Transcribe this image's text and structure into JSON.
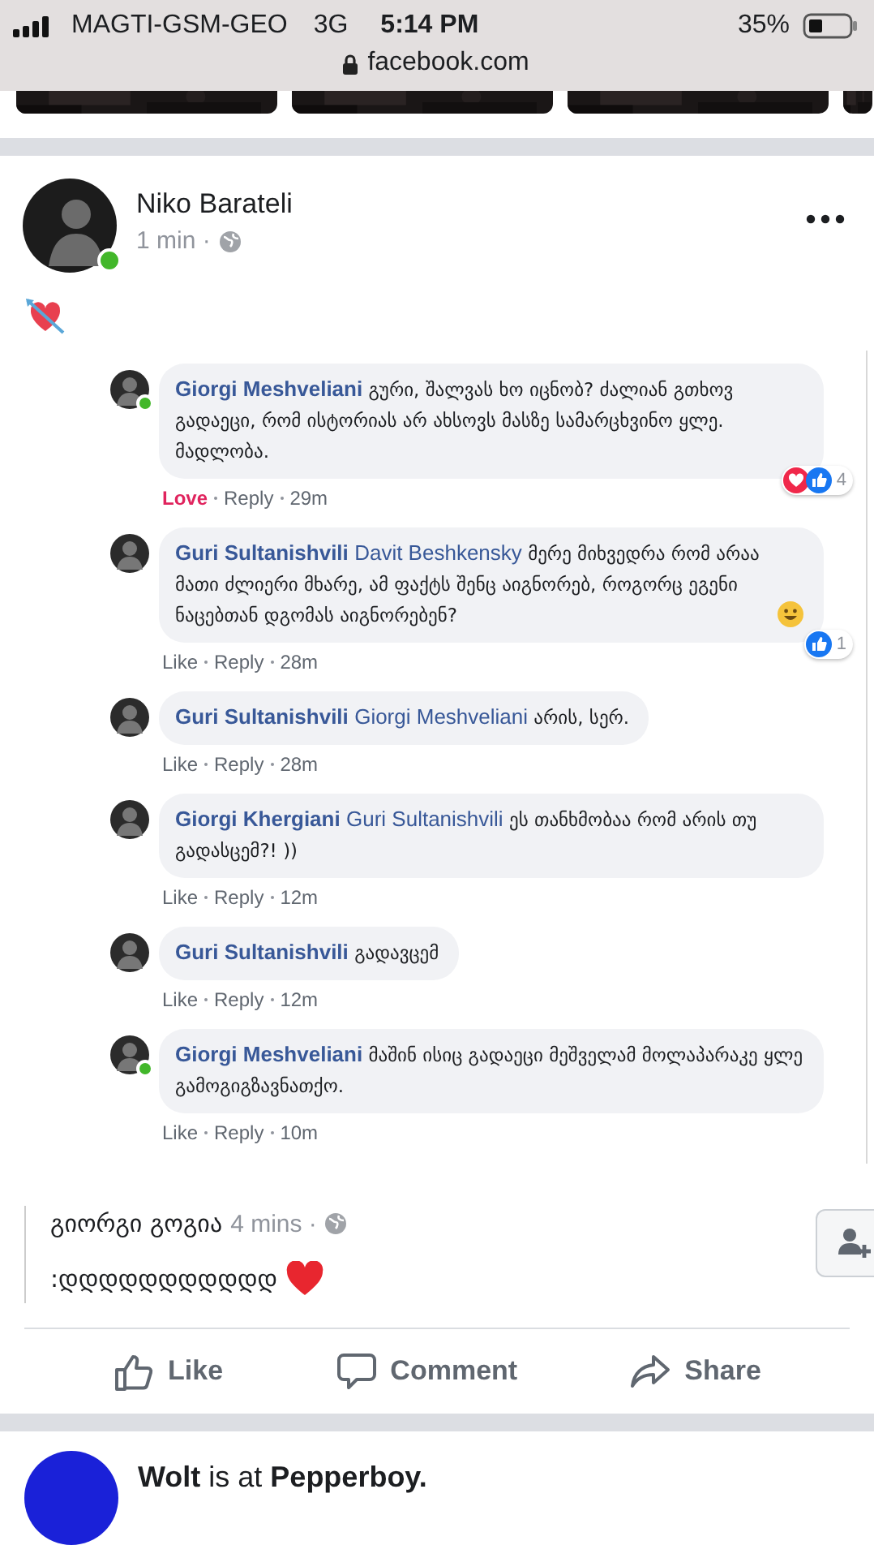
{
  "status_bar": {
    "carrier": "MAGTI-GSM-GEO",
    "network": "3G",
    "time": "5:14 PM",
    "battery": "35%",
    "url": "facebook.com"
  },
  "post": {
    "author": "Niko Barateli",
    "online": true,
    "time": "1 min ·"
  },
  "thread": [
    {
      "author": "Giorgi Meshveliani",
      "online": true,
      "text": "გური, შალვას ხო იცნობ? ძალიან გთხოვ გადაეცი, რომ ისტორიას არ ახსოვს მასზე სამარცხვინო ყლე. მადლობა.",
      "emoji": false,
      "reacted": true,
      "reaction_label": "Love",
      "reply": "Reply",
      "age": "29m",
      "reactions": {
        "icons": [
          {
            "kind": "love"
          },
          {
            "kind": "like"
          }
        ],
        "count": "4"
      }
    },
    {
      "author": "Guri Sultanishvili",
      "online": false,
      "mention": "Davit Beshkensky",
      "text": "მერე მიხვედრა რომ არაა მათი ძლიერი მხარე, ამ ფაქტს შენც აიგნორებ, როგორც ეგენი ნაცებთან დგომას აიგნორებენ?",
      "emoji": true,
      "reacted": false,
      "reaction_label": "Like",
      "reply": "Reply",
      "age": "28m",
      "reactions": {
        "icons": [
          {
            "kind": "like"
          }
        ],
        "count": "1"
      }
    },
    {
      "author": "Guri Sultanishvili",
      "online": false,
      "mention": "Giorgi Meshveliani",
      "text": "არის, სერ.",
      "emoji": false,
      "reacted": false,
      "reaction_label": "Like",
      "reply": "Reply",
      "age": "28m"
    },
    {
      "author": "Giorgi Khergiani",
      "online": false,
      "mention": "Guri Sultanishvili",
      "text": "ეს თანხმობაა რომ არის თუ გადასცემ?! ))",
      "emoji": false,
      "reacted": false,
      "reaction_label": "Like",
      "reply": "Reply",
      "age": "12m"
    },
    {
      "author": "Guri Sultanishvili",
      "online": false,
      "text": "გადავცემ",
      "emoji": false,
      "reacted": false,
      "reaction_label": "Like",
      "reply": "Reply",
      "age": "12m"
    },
    {
      "author": "Giorgi Meshveliani",
      "online": true,
      "text": "მაშინ ისიც გადაეცი მეშველამ მოლაპარაკე ყლე გამოგიგზავნათქო.",
      "emoji": false,
      "reacted": false,
      "reaction_label": "Like",
      "reply": "Reply",
      "age": "10m"
    }
  ],
  "shared": {
    "author": "გიორგი გოგია",
    "time": "4 mins ·",
    "text": ":დდდდდდდდდდდ"
  },
  "actions": [
    {
      "kind": "like",
      "label": "Like"
    },
    {
      "kind": "comment",
      "label": "Comment"
    },
    {
      "kind": "share",
      "label": "Share"
    }
  ],
  "next_post": {
    "text": "**Wolt** is at **Pepperboy.**"
  }
}
